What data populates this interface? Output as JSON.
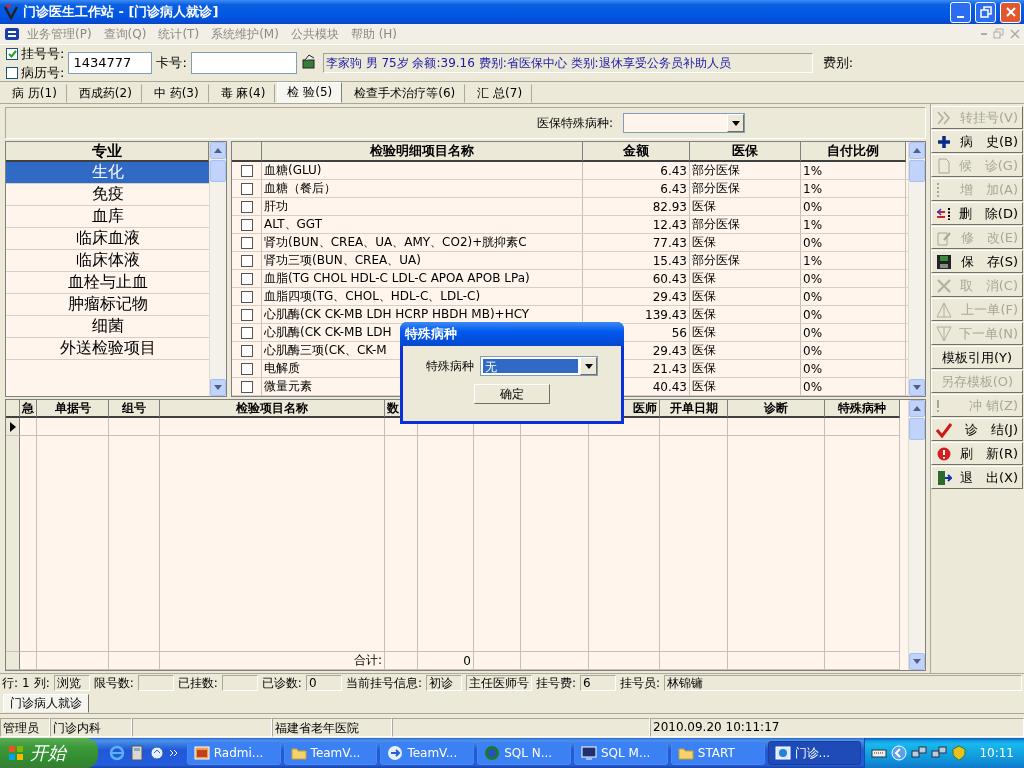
{
  "window": {
    "title": "门诊医生工作站 - [门诊病人就诊]"
  },
  "menu": [
    "业务管理(P)",
    "查询(Q)",
    "统计(T)",
    "系统维护(M)",
    "公共模块",
    "帮助 (H)"
  ],
  "patient_bar": {
    "registration": {
      "label": "挂号号:",
      "checked": true
    },
    "record": {
      "label": "病历号:",
      "checked": false
    },
    "registration_value": "1434777",
    "card_label": "卡号:",
    "info": "李家驹 男 75岁 余额:39.16 费别:省医保中心 类别:退休享受公务员补助人员",
    "fee_label": "费别:"
  },
  "tabs": [
    {
      "label": "病 历(1)",
      "selected": false
    },
    {
      "label": "西成药(2)",
      "selected": false
    },
    {
      "label": "中 药(3)",
      "selected": false
    },
    {
      "label": "毒 麻(4)",
      "selected": false
    },
    {
      "label": "检 验(5)",
      "selected": true
    },
    {
      "label": "检查手术治疗等(6)",
      "selected": false
    },
    {
      "label": "汇 总(7)",
      "selected": false
    }
  ],
  "filter": {
    "label": "医保特殊病种:"
  },
  "category_list": {
    "header": "专业",
    "items": [
      {
        "label": "生化",
        "selected": true
      },
      {
        "label": "免疫",
        "selected": false
      },
      {
        "label": "血库",
        "selected": false
      },
      {
        "label": "临床血液",
        "selected": false
      },
      {
        "label": "临床体液",
        "selected": false
      },
      {
        "label": "血栓与止血",
        "selected": false
      },
      {
        "label": "肿瘤标记物",
        "selected": false
      },
      {
        "label": "细菌",
        "selected": false
      },
      {
        "label": "外送检验项目",
        "selected": false
      }
    ]
  },
  "item_table": {
    "columns": [
      "检验明细项目名称",
      "金额",
      "医保",
      "自付比例"
    ],
    "rows": [
      {
        "checked": false,
        "name": "血糖(GLU)",
        "amount": "6.43",
        "insurance": "部分医保",
        "ratio": "1%"
      },
      {
        "checked": false,
        "name": "血糖（餐后）",
        "amount": "6.43",
        "insurance": "部分医保",
        "ratio": "1%"
      },
      {
        "checked": false,
        "name": "肝功",
        "amount": "82.93",
        "insurance": "医保",
        "ratio": "0%"
      },
      {
        "checked": false,
        "name": "ALT、GGT",
        "amount": "12.43",
        "insurance": "部分医保",
        "ratio": "1%"
      },
      {
        "checked": false,
        "name": "肾功(BUN、CREA、UA、AMY、CO2)+胱抑素C",
        "amount": "77.43",
        "insurance": "医保",
        "ratio": "0%"
      },
      {
        "checked": false,
        "name": "肾功三项(BUN、CREA、UA)",
        "amount": "15.43",
        "insurance": "部分医保",
        "ratio": "1%"
      },
      {
        "checked": false,
        "name": "血脂(TG CHOL HDL-C LDL-C APOA APOB LPa)",
        "amount": "60.43",
        "insurance": "医保",
        "ratio": "0%"
      },
      {
        "checked": false,
        "name": "血脂四项(TG、CHOL、HDL-C、LDL-C)",
        "amount": "29.43",
        "insurance": "医保",
        "ratio": "0%"
      },
      {
        "checked": false,
        "name": "心肌酶(CK CK-MB LDH HCRP HBDH MB)+HCY",
        "amount": "139.43",
        "insurance": "医保",
        "ratio": "0%"
      },
      {
        "checked": false,
        "name": "心肌酶(CK CK-MB LDH",
        "amount": "56",
        "insurance": "医保",
        "ratio": "0%"
      },
      {
        "checked": false,
        "name": "心肌酶三项(CK、CK-M",
        "amount": "29.43",
        "insurance": "医保",
        "ratio": "0%"
      },
      {
        "checked": false,
        "name": "电解质",
        "amount": "21.43",
        "insurance": "医保",
        "ratio": "0%"
      },
      {
        "checked": false,
        "name": "微量元素",
        "amount": "40.43",
        "insurance": "医保",
        "ratio": "0%"
      }
    ]
  },
  "order_table": {
    "columns": [
      "急",
      "单据号",
      "组号",
      "检验项目名称",
      "数",
      "医师",
      "开单日期",
      "诊断",
      "特殊病种"
    ],
    "total_label": "合计:",
    "total": "0"
  },
  "dialog": {
    "title": "特殊病种",
    "label": "特殊病种",
    "value": "无",
    "button": "确定"
  },
  "actions": [
    {
      "label": "转挂号(V)",
      "disabled": true
    },
    {
      "label": "病　史(B)",
      "disabled": false
    },
    {
      "label": "候　诊(G)",
      "disabled": true
    },
    {
      "label": "增　加(A)",
      "disabled": true
    },
    {
      "label": "删　除(D)",
      "disabled": false
    },
    {
      "label": "修　改(E)",
      "disabled": true
    },
    {
      "label": "保　存(S)",
      "disabled": false
    },
    {
      "label": "取　消(C)",
      "disabled": true
    },
    {
      "label": "上一单(F)",
      "disabled": true
    },
    {
      "label": "下一单(N)",
      "disabled": true
    },
    {
      "label": "模板引用(Y)",
      "disabled": false
    },
    {
      "label": "另存模板(O)",
      "disabled": true
    },
    {
      "label": "冲 销(Z)",
      "disabled": true
    },
    {
      "label": "诊　结(J)",
      "disabled": false
    },
    {
      "label": "刷　新(R)",
      "disabled": false
    },
    {
      "label": "退　出(X)",
      "disabled": false
    }
  ],
  "status_bar": [
    {
      "kind": "label",
      "text": "行:"
    },
    {
      "kind": "label",
      "text": "1"
    },
    {
      "kind": "label",
      "text": "列:"
    },
    {
      "kind": "box",
      "text": "浏览"
    },
    {
      "kind": "label",
      "text": "限号数:"
    },
    {
      "kind": "box"
    },
    {
      "kind": "label",
      "text": "已挂数:"
    },
    {
      "kind": "box"
    },
    {
      "kind": "label",
      "text": "已诊数:"
    },
    {
      "kind": "box",
      "text": "0"
    },
    {
      "kind": "label",
      "text": "当前挂号信息:"
    },
    {
      "kind": "box",
      "text": "初诊"
    },
    {
      "kind": "box",
      "text": "主任医师号"
    },
    {
      "kind": "label",
      "text": "挂号费:"
    },
    {
      "kind": "box",
      "text": "6"
    },
    {
      "kind": "label",
      "text": "挂号员:"
    },
    {
      "kind": "box",
      "text": "林锦镛"
    }
  ],
  "mdi_tabs": [
    {
      "label": "门诊病人就诊",
      "selected": true
    }
  ],
  "footer": [
    {
      "kind": "text",
      "text": "管理员"
    },
    {
      "kind": "text",
      "text": "门诊内科"
    },
    {
      "kind": "blank"
    },
    {
      "kind": "text",
      "text": "福建省老年医院"
    },
    {
      "kind": "blank"
    },
    {
      "kind": "text",
      "text": "2010.09.20 10:11:17"
    }
  ],
  "taskbar": {
    "start": "开始",
    "tasks": [
      {
        "label": "Radmi...",
        "selected": false
      },
      {
        "label": "TeamV...",
        "selected": false
      },
      {
        "label": "TeamV...",
        "selected": false
      },
      {
        "label": "SQL N...",
        "selected": false
      },
      {
        "label": "SQL M...",
        "selected": false
      },
      {
        "label": "START",
        "selected": false
      },
      {
        "label": "门诊...",
        "selected": true
      }
    ],
    "clock": "10:11"
  }
}
